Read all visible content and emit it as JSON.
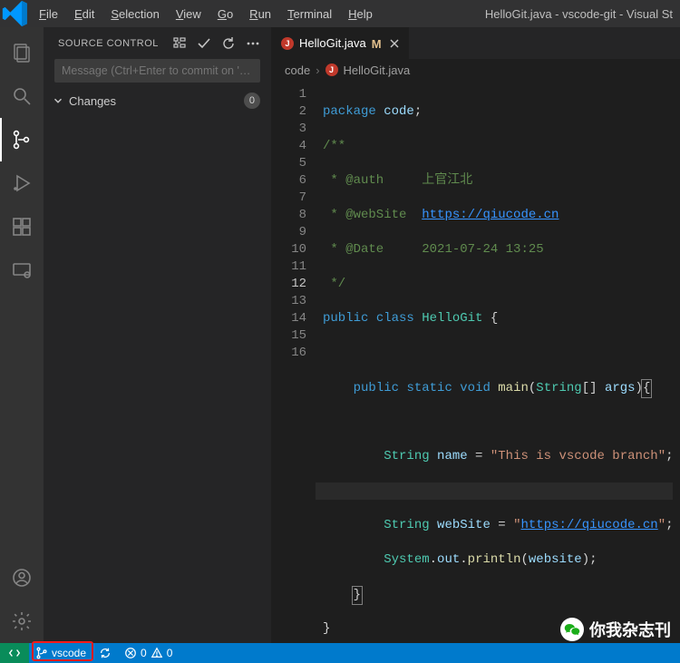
{
  "window_title": "HelloGit.java - vscode-git - Visual St",
  "menu": {
    "file": "File",
    "edit": "Edit",
    "selection": "Selection",
    "view": "View",
    "go": "Go",
    "run": "Run",
    "terminal": "Terminal",
    "help": "Help"
  },
  "sidebar": {
    "title": "Source Control",
    "message_placeholder": "Message (Ctrl+Enter to commit on '…",
    "changes_label": "Changes",
    "changes_count": "0"
  },
  "tab": {
    "label": "HelloGit.java",
    "modified_marker": "M"
  },
  "breadcrumb": {
    "folder": "code",
    "file": "HelloGit.java"
  },
  "code": {
    "l1_pkg": "package",
    "l1_ns": "code",
    "c_open": "/**",
    "c_auth_tag": " * @auth",
    "c_auth_val": "上官江北",
    "c_web_tag": " * @webSite",
    "c_web_val": "https://qiucode.cn",
    "c_date_tag": " * @Date",
    "c_date_val": "2021-07-24 13:25",
    "c_close": " */",
    "l7_public": "public",
    "l7_class": "class",
    "l7_name": "HelloGit",
    "l9_public": "public",
    "l9_static": "static",
    "l9_void": "void",
    "l9_main": "main",
    "l9_arg_t": "String",
    "l9_arg_n": "args",
    "l11_type": "String",
    "l11_var": "name",
    "l11_val": "\"This is vscode branch\"",
    "l13_type": "String",
    "l13_var": "webSite",
    "l13_val_q1": "\"",
    "l13_val_link": "https://qiucode.cn",
    "l13_val_q2": "\"",
    "l14_sys": "System",
    "l14_out": "out",
    "l14_println": "println",
    "l14_arg": "website"
  },
  "statusbar": {
    "branch": "vscode",
    "errors": "0",
    "warnings": "0"
  },
  "watermark": "你我杂志刊"
}
